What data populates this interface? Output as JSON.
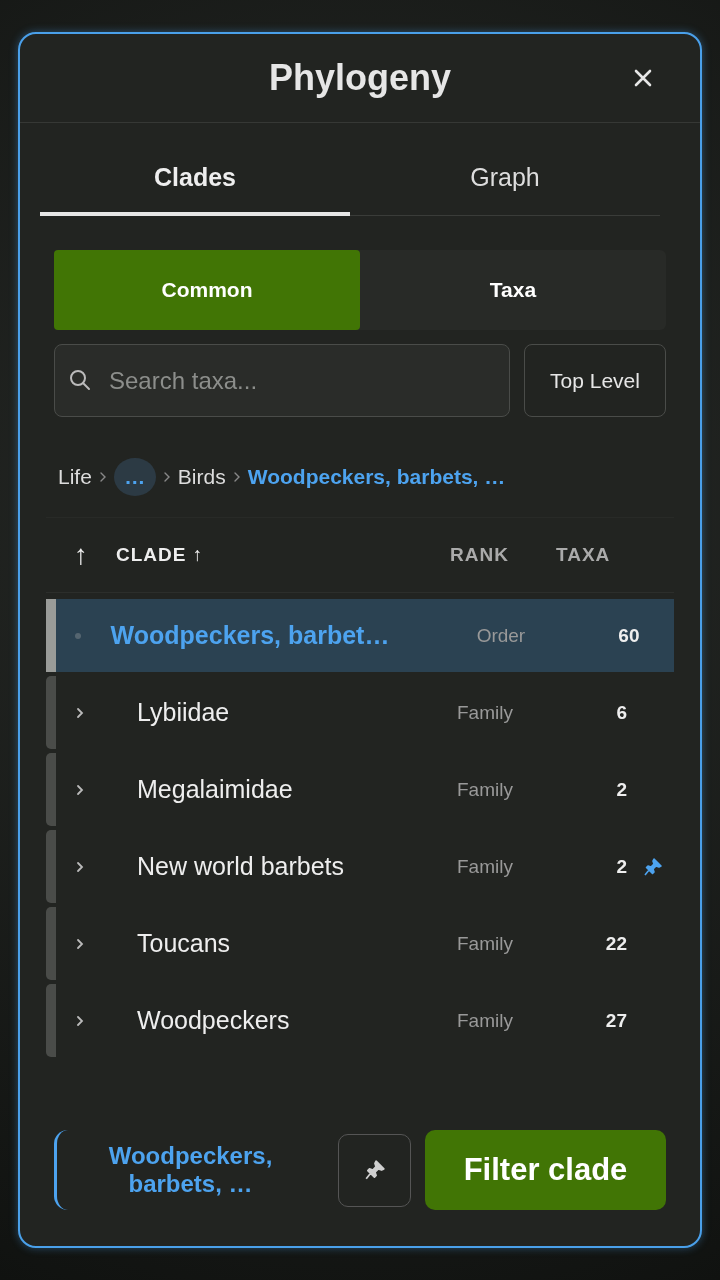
{
  "title": "Phylogeny",
  "tabs": [
    {
      "label": "Clades",
      "selected": true
    },
    {
      "label": "Graph",
      "selected": false
    }
  ],
  "segments": [
    {
      "label": "Common",
      "selected": true
    },
    {
      "label": "Taxa",
      "selected": false
    }
  ],
  "search": {
    "placeholder": "Search taxa..."
  },
  "top_level_button": "Top Level",
  "breadcrumb": [
    {
      "label": "Life",
      "kind": "link"
    },
    {
      "label": "…",
      "kind": "ellipsis"
    },
    {
      "label": "Birds",
      "kind": "link"
    },
    {
      "label": "Woodpeckers, barbets, …",
      "kind": "current"
    }
  ],
  "table": {
    "up_arrow": "↑",
    "columns": [
      "CLADE ↑",
      "RANK",
      "TAXA"
    ],
    "rows": [
      {
        "name": "Woodpeckers, barbet…",
        "rank": "Order",
        "taxa": "60",
        "kind": "parent",
        "selected": true,
        "pinned": false
      },
      {
        "name": "Lybiidae",
        "rank": "Family",
        "taxa": "6",
        "kind": "child",
        "selected": false,
        "pinned": false
      },
      {
        "name": "Megalaimidae",
        "rank": "Family",
        "taxa": "2",
        "kind": "child",
        "selected": false,
        "pinned": false
      },
      {
        "name": "New world barbets",
        "rank": "Family",
        "taxa": "2",
        "kind": "child",
        "selected": false,
        "pinned": true
      },
      {
        "name": "Toucans",
        "rank": "Family",
        "taxa": "22",
        "kind": "child",
        "selected": false,
        "pinned": false
      },
      {
        "name": "Woodpeckers",
        "rank": "Family",
        "taxa": "27",
        "kind": "child",
        "selected": false,
        "pinned": false
      }
    ]
  },
  "footer": {
    "selection": "Woodpeckers, barbets, …",
    "filter_button": "Filter clade"
  }
}
